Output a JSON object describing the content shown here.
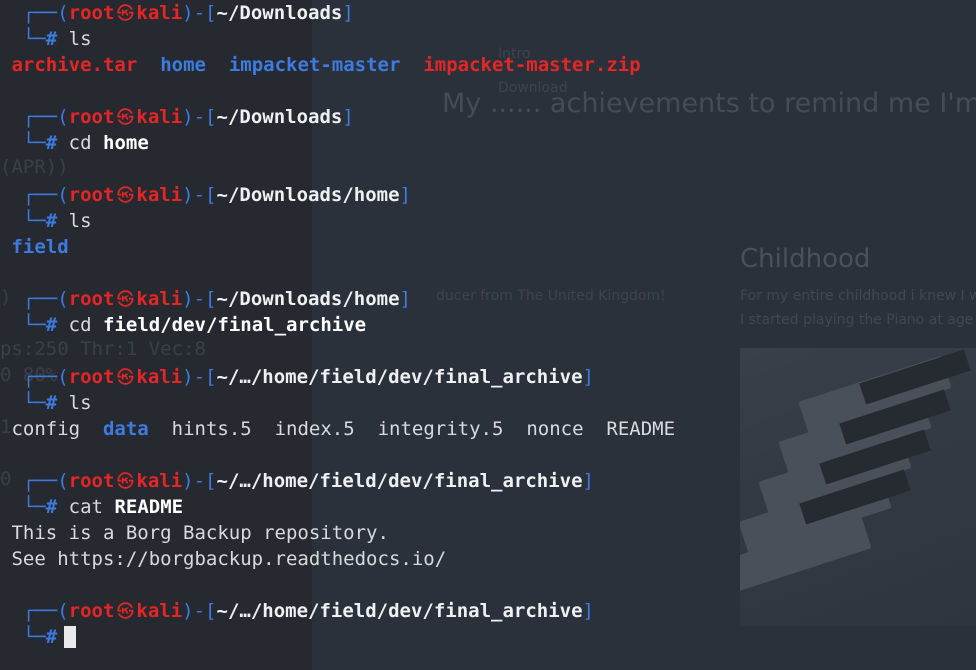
{
  "background": {
    "page_title_fragment": "My ...... achievements to remind me I'm d",
    "nav_links": [
      "Intro",
      "Download"
    ],
    "section_heading": "Childhood",
    "paragraph_1": "For my entire childhood i knew I w",
    "paragraph_2": "I started playing the Piano at age",
    "subtitle_fragment": "ducer from The United Kingdom!",
    "left_fragments": [
      "(APR))",
      ")",
      "ps:250 Thr:1 Vec:8",
      "0 80%",
      "1",
      "0"
    ]
  },
  "prompt": {
    "user": "root",
    "skull": "㉿",
    "host": "kali"
  },
  "blocks": [
    {
      "path": "~/Downloads",
      "command": "ls",
      "arg": ""
    },
    {
      "path": "~/Downloads",
      "command": "cd",
      "arg": "home"
    },
    {
      "path": "~/Downloads/home",
      "command": "ls",
      "arg": ""
    },
    {
      "path": "~/Downloads/home",
      "command": "cd",
      "arg": "field/dev/final_archive"
    },
    {
      "path": "~/…/home/field/dev/final_archive",
      "command": "ls",
      "arg": ""
    },
    {
      "path": "~/…/home/field/dev/final_archive",
      "command": "cat",
      "arg": "README"
    },
    {
      "path": "~/…/home/field/dev/final_archive",
      "command": "",
      "arg": ""
    }
  ],
  "outputs": {
    "downloads_listing": [
      "archive.tar",
      "home",
      "impacket-master",
      "impacket-master.zip"
    ],
    "home_listing": [
      "field"
    ],
    "archive_listing": [
      "config",
      "data",
      "hints.5",
      "index.5",
      "integrity.5",
      "nonce",
      "README"
    ],
    "readme_lines": [
      "This is a Borg Backup repository.",
      "See https://borgbackup.readthedocs.io/"
    ]
  },
  "colors": {
    "accent_blue": "#3d7be0",
    "prompt_red": "#e52626",
    "terminal_bg": "#262a30"
  }
}
